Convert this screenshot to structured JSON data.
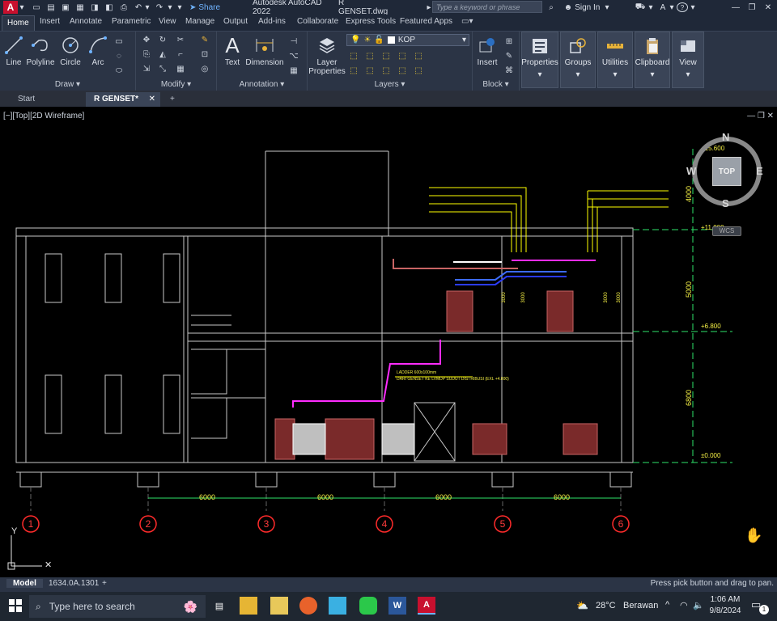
{
  "titlebar": {
    "app_title": "Autodesk AutoCAD 2022",
    "file_title": "R GENSET.dwg",
    "search_placeholder": "Type a keyword or phrase",
    "sign_in": "Sign In",
    "share": "Share"
  },
  "menu": [
    "Home",
    "Insert",
    "Annotate",
    "Parametric",
    "View",
    "Manage",
    "Output",
    "Add-ins",
    "Collaborate",
    "Express Tools",
    "Featured Apps"
  ],
  "ribbon": {
    "draw": {
      "label": "Draw",
      "tools": [
        "Line",
        "Polyline",
        "Circle",
        "Arc"
      ]
    },
    "modify": {
      "label": "Modify"
    },
    "annotation": {
      "label": "Annotation",
      "tools": [
        "Text",
        "Dimension"
      ]
    },
    "layers": {
      "label": "Layers",
      "tool": "Layer Properties",
      "current_layer": "KOP"
    },
    "block": {
      "label": "Block",
      "tool": "Insert"
    },
    "panels": [
      "Properties",
      "Groups",
      "Utilities",
      "Clipboard",
      "View"
    ]
  },
  "doctabs": {
    "start": "Start",
    "active": "R GENSET*"
  },
  "viewport": {
    "label": "[−][Top][2D Wireframe]",
    "viewcube": {
      "top": "TOP",
      "n": "N",
      "s": "S",
      "e": "E",
      "w": "W",
      "wcs": "WCS"
    }
  },
  "drawing": {
    "grid_labels": [
      "1",
      "2",
      "3",
      "4",
      "5",
      "6"
    ],
    "spans": [
      "6000",
      "6000",
      "6000",
      "6000",
      "6000"
    ],
    "levels": [
      "+15.600",
      "+11.800",
      "+6.800",
      "±0.000"
    ],
    "heights": [
      "4000",
      "5000",
      "6800"
    ],
    "ladder_note": "LADDER 600x100mm",
    "ladder_sub": "DARI GENSET KE LVMDP SUDUT DISTRIBUSI (EXL +4.800)",
    "dim_small": [
      "3000",
      "3000",
      "3000",
      "3000"
    ]
  },
  "layouttabs": {
    "model": "Model",
    "layout": "1634.0A.1301"
  },
  "status_prompt": "Press pick button and drag to pan.",
  "taskbar": {
    "search": "Type here to search",
    "weather_temp": "28°C",
    "weather_text": "Berawan",
    "time": "1:06 AM",
    "date": "9/8/2024",
    "notifications": "1"
  },
  "colors": {
    "accent": "#4a90e2",
    "autocad_red": "#c8102e",
    "cad_yellow": "#ffff00",
    "cad_magenta": "#ff00ff",
    "cad_green": "#00ff00",
    "cad_blue": "#2a3bff",
    "cad_red": "#b94a4a"
  }
}
